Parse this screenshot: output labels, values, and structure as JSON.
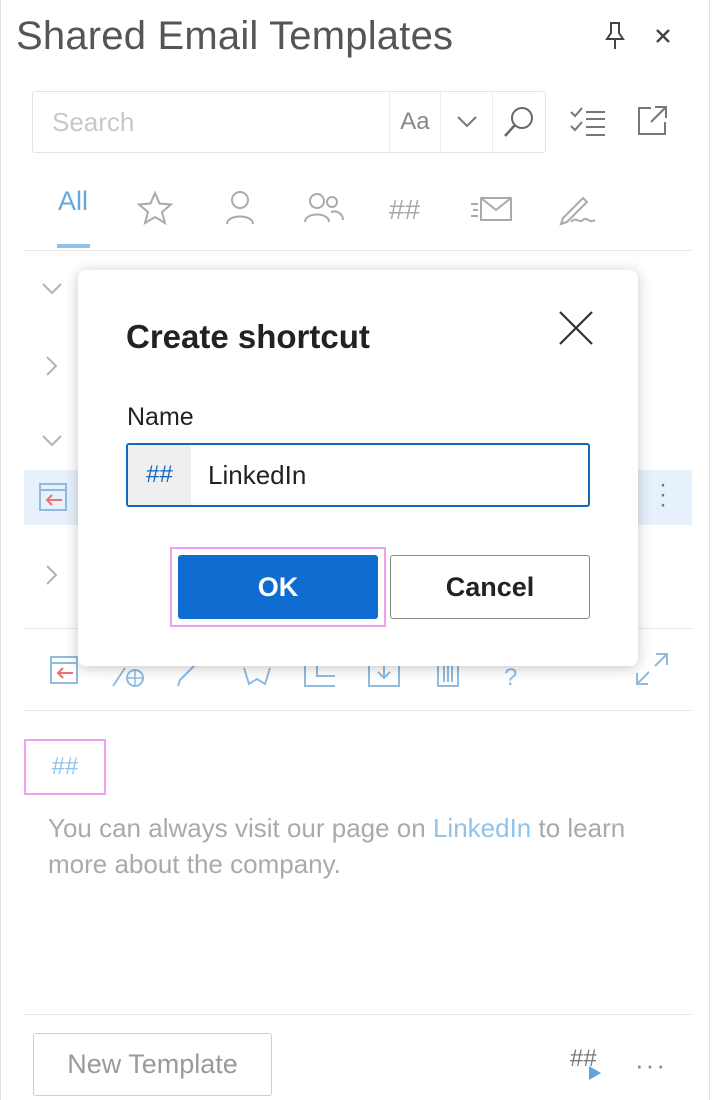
{
  "header": {
    "title": "Shared Email Templates",
    "pin_icon": "pin-icon",
    "close_icon": "close-icon"
  },
  "search": {
    "placeholder": "Search",
    "match_case_label": "Aa"
  },
  "tabs": [
    {
      "label": "All",
      "icon": "none",
      "active": true
    },
    {
      "label": "",
      "icon": "star-icon"
    },
    {
      "label": "",
      "icon": "person-icon"
    },
    {
      "label": "",
      "icon": "people-icon"
    },
    {
      "label": "",
      "icon": "hash-icon"
    },
    {
      "label": "",
      "icon": "mail-send-icon"
    },
    {
      "label": "",
      "icon": "signature-icon"
    }
  ],
  "dialog": {
    "title": "Create shortcut",
    "name_label": "Name",
    "prefix": "##",
    "name_value": "LinkedIn",
    "ok_label": "OK",
    "cancel_label": "Cancel"
  },
  "preview": {
    "tag": "##",
    "text_before": "You can always visit our page on ",
    "link_text": "LinkedIn",
    "text_after": " to learn more about the company."
  },
  "footer": {
    "new_template_label": "New Template"
  },
  "colors": {
    "accent": "#0f6cd1",
    "accent_light": "#8fc3ea",
    "highlight": "#f0a0ee"
  }
}
